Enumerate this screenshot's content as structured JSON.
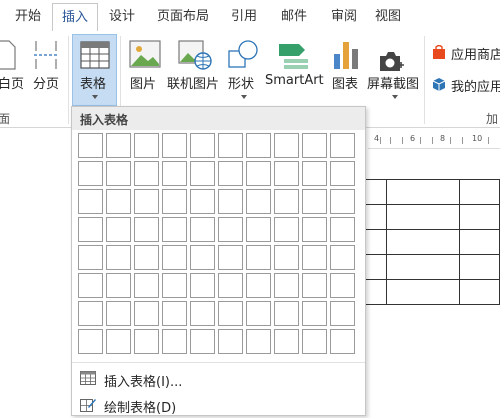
{
  "tabs": [
    {
      "label": "开始"
    },
    {
      "label": "插入",
      "active": true
    },
    {
      "label": "设计"
    },
    {
      "label": "页面布局"
    },
    {
      "label": "引用"
    },
    {
      "label": "邮件"
    },
    {
      "label": "审阅"
    },
    {
      "label": "视图"
    }
  ],
  "ribbon": {
    "pages_group": {
      "blank_page": "白页",
      "page_break": "分页",
      "label": "面"
    },
    "tables_group": {
      "table": "表格"
    },
    "illustrations_group": {
      "picture": "图片",
      "online_picture": "联机图片",
      "shapes": "形状",
      "smartart": "SmartArt",
      "chart": "图表",
      "screenshot": "屏幕截图"
    },
    "apps_group": {
      "store": "应用商店",
      "my_apps": "我的应用",
      "label": "加"
    }
  },
  "ruler": {
    "ticks": [
      "4",
      "6",
      "8",
      "10"
    ]
  },
  "dropdown": {
    "title": "插入表格",
    "grid_cols": 10,
    "grid_rows": 8,
    "menu": [
      {
        "label": "插入表格(I)...",
        "icon": "insert-table-icon"
      },
      {
        "label": "绘制表格(D)",
        "icon": "draw-table-icon"
      }
    ]
  },
  "colors": {
    "accent": "#2b579a",
    "pressed": "#c5dcf2",
    "store_icon": "#e8491d",
    "my_apps_icon": "#2e75b6"
  }
}
